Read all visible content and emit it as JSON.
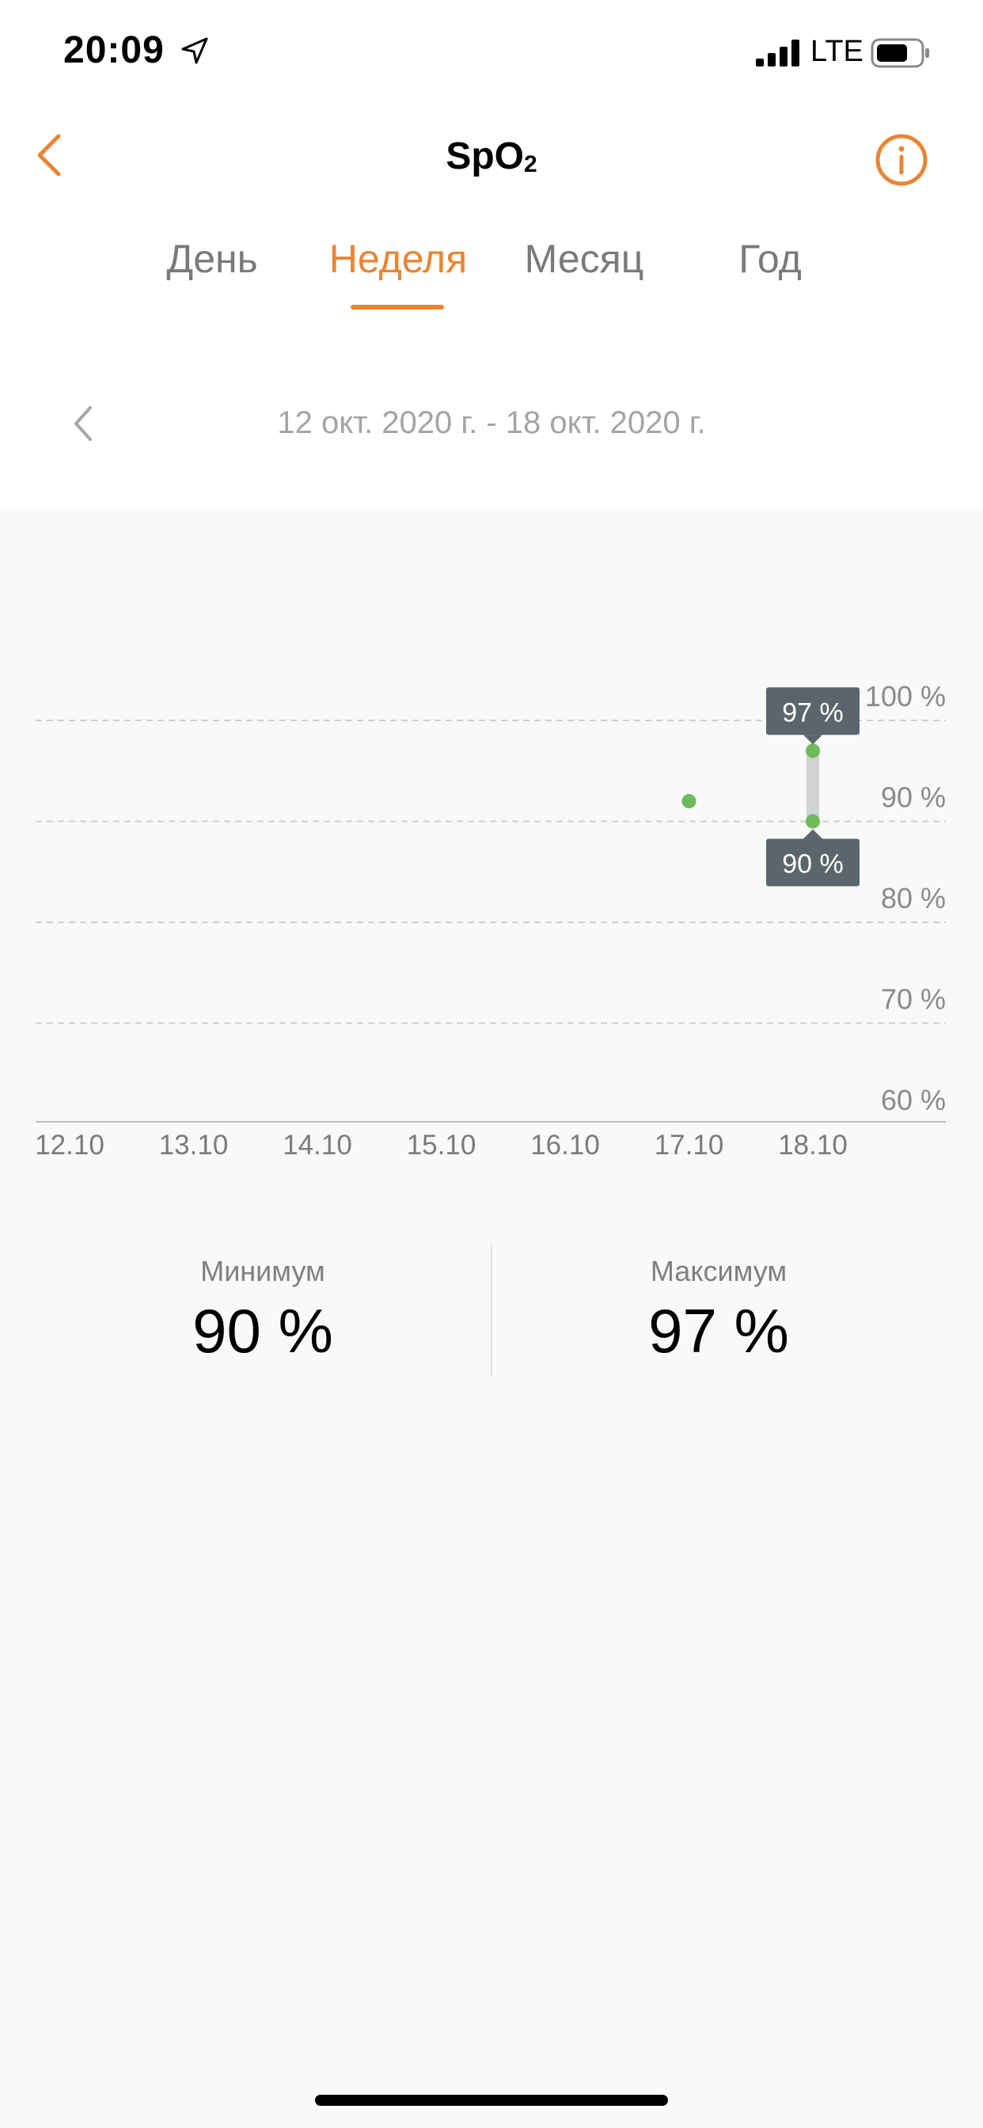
{
  "status_bar": {
    "time": "20:09",
    "network": "LTE",
    "icons": [
      "location-arrow-icon",
      "signal-bars-icon",
      "battery-icon"
    ]
  },
  "nav": {
    "title_main": "SpO",
    "title_sub": "2",
    "back_icon": "chevron-left-icon",
    "info_icon": "info-circle-icon"
  },
  "tabs": [
    {
      "label": "День",
      "active": false
    },
    {
      "label": "Неделя",
      "active": true
    },
    {
      "label": "Месяц",
      "active": false
    },
    {
      "label": "Год",
      "active": false
    }
  ],
  "date_range": "12 окт. 2020 г. - 18 окт. 2020 г.",
  "colors": {
    "accent": "#ea8434",
    "point": "#6dbb5a",
    "tooltip": "#5b666c",
    "background": "#f8f9f9"
  },
  "chart_data": {
    "type": "scatter",
    "x": [
      "12.10",
      "13.10",
      "14.10",
      "15.10",
      "16.10",
      "17.10",
      "18.10"
    ],
    "y_ticks": [
      "100 %",
      "90 %",
      "80 %",
      "70 %",
      "60 %"
    ],
    "ylim": [
      60,
      100
    ],
    "grid": true,
    "points": [
      {
        "x": "17.10",
        "y": 92
      },
      {
        "x": "18.10",
        "y": 97
      },
      {
        "x": "18.10",
        "y": 90
      }
    ],
    "range_bars": [
      {
        "x": "18.10",
        "min": 90,
        "max": 97
      }
    ],
    "labels": [
      {
        "x": "18.10",
        "y": 97,
        "text": "97 %",
        "position": "above"
      },
      {
        "x": "18.10",
        "y": 90,
        "text": "90 %",
        "position": "below"
      }
    ]
  },
  "stats": {
    "min_label": "Минимум",
    "min_value": "90 %",
    "max_label": "Максимум",
    "max_value": "97 %"
  }
}
